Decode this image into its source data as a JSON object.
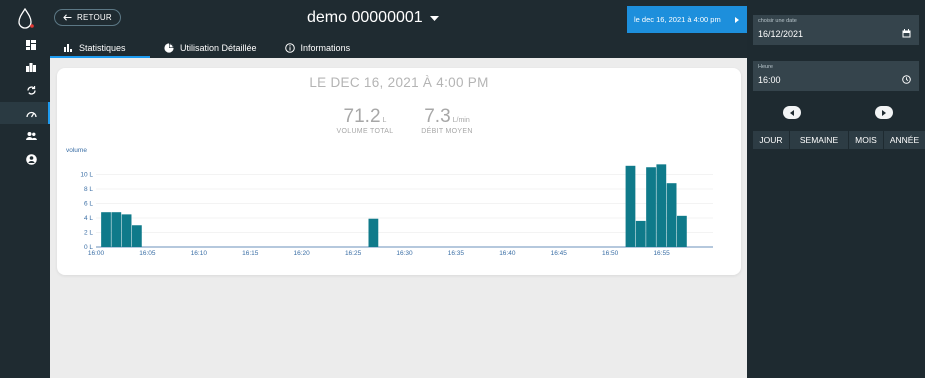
{
  "nav": {
    "back_label": "RETOUR",
    "rail_items": [
      "logo",
      "dashboard",
      "analytics",
      "alerts",
      "gauge",
      "users",
      "account"
    ]
  },
  "header": {
    "device_title": "demo 00000001",
    "date_button": "le dec 16, 2021 à 4:00 pm"
  },
  "tabs": [
    {
      "label": "Statistiques",
      "icon": "bar-chart-icon",
      "active": true
    },
    {
      "label": "Utilisation Détaillée",
      "icon": "pie-chart-icon",
      "active": false
    },
    {
      "label": "Informations",
      "icon": "info-icon",
      "active": false
    }
  ],
  "card": {
    "title": "LE DEC 16, 2021 À 4:00 PM",
    "total_value": "71.2",
    "total_unit": "L",
    "total_caption": "VOLUME TOTAL",
    "avg_value": "7.3",
    "avg_unit": "L/min",
    "avg_caption": "DÉBIT MOYEN"
  },
  "chart_data": {
    "type": "bar",
    "ylabel": "volume",
    "y_ticks": [
      "0 L",
      "2 L",
      "4 L",
      "6 L",
      "8 L",
      "10 L"
    ],
    "ylim": [
      0,
      12
    ],
    "x_ticks": [
      "16:00",
      "16:05",
      "16:10",
      "16:15",
      "16:20",
      "16:25",
      "16:30",
      "16:35",
      "16:40",
      "16:45",
      "16:50",
      "16:55"
    ],
    "x_unit": "minutes after 16:00",
    "bars": [
      {
        "x": 1,
        "value": 4.8
      },
      {
        "x": 2,
        "value": 4.8
      },
      {
        "x": 3,
        "value": 4.5
      },
      {
        "x": 4,
        "value": 3.0
      },
      {
        "x": 27,
        "value": 3.9
      },
      {
        "x": 52,
        "value": 11.2
      },
      {
        "x": 53,
        "value": 3.6
      },
      {
        "x": 54,
        "value": 11.0
      },
      {
        "x": 55,
        "value": 11.4
      },
      {
        "x": 56,
        "value": 8.8
      },
      {
        "x": 57,
        "value": 4.3
      }
    ],
    "grid": true,
    "bar_color": "#0f7a8a"
  },
  "right": {
    "date_label": "choisir une date",
    "date_value": "16/12/2021",
    "time_label": "Heure",
    "time_value": "16:00",
    "periods": [
      "JOUR",
      "SEMAINE",
      "MOIS",
      "ANNÉE"
    ]
  }
}
